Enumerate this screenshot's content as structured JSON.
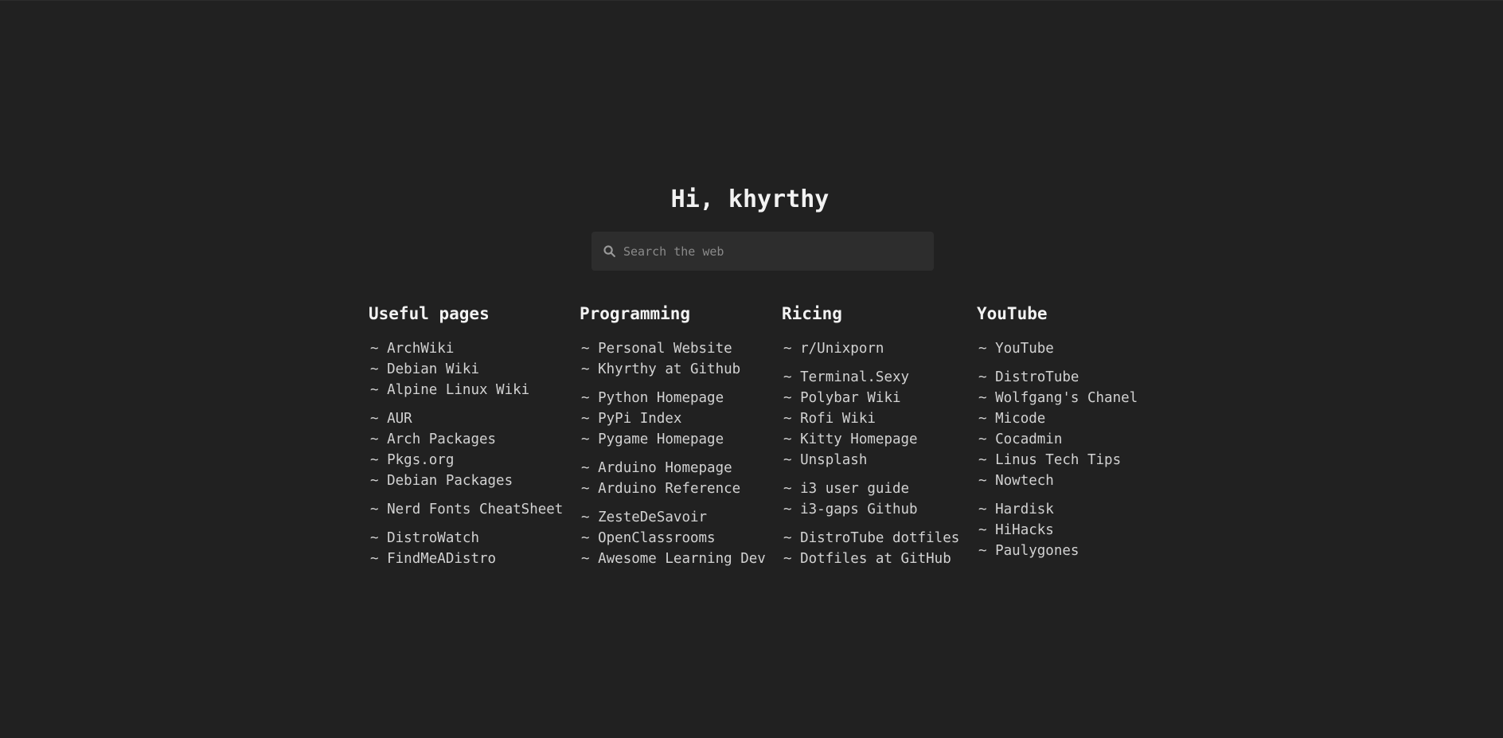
{
  "greeting": "Hi, khyrthy",
  "search": {
    "placeholder": "Search the web",
    "value": ""
  },
  "link_prefix": "~",
  "columns": [
    {
      "title": "Useful pages",
      "groups": [
        [
          "ArchWiki",
          "Debian Wiki",
          "Alpine Linux Wiki"
        ],
        [
          "AUR",
          "Arch Packages",
          "Pkgs.org",
          "Debian Packages"
        ],
        [
          "Nerd Fonts CheatSheet"
        ],
        [
          "DistroWatch",
          "FindMeADistro"
        ]
      ]
    },
    {
      "title": "Programming",
      "groups": [
        [
          "Personal Website",
          "Khyrthy at Github"
        ],
        [
          "Python Homepage",
          "PyPi Index",
          "Pygame Homepage"
        ],
        [
          "Arduino Homepage",
          "Arduino Reference"
        ],
        [
          "ZesteDeSavoir",
          "OpenClassrooms",
          "Awesome Learning Dev"
        ]
      ]
    },
    {
      "title": "Ricing",
      "groups": [
        [
          "r/Unixporn"
        ],
        [
          "Terminal.Sexy",
          "Polybar Wiki",
          "Rofi Wiki",
          "Kitty Homepage",
          "Unsplash"
        ],
        [
          "i3 user guide",
          "i3-gaps Github"
        ],
        [
          "DistroTube dotfiles",
          "Dotfiles at GitHub"
        ]
      ]
    },
    {
      "title": "YouTube",
      "groups": [
        [
          "YouTube"
        ],
        [
          "DistroTube",
          "Wolfgang's Chanel",
          "Micode",
          "Cocadmin",
          "Linus Tech Tips",
          "Nowtech"
        ],
        [
          "Hardisk",
          "HiHacks",
          "Paulygones"
        ]
      ]
    }
  ],
  "icons": {
    "search": "search-icon"
  },
  "colors": {
    "background": "#212121",
    "search_background": "#2d2d2d",
    "heading": "#f2f2f2",
    "link": "#d2d2d2",
    "placeholder": "#8a8a8a"
  }
}
